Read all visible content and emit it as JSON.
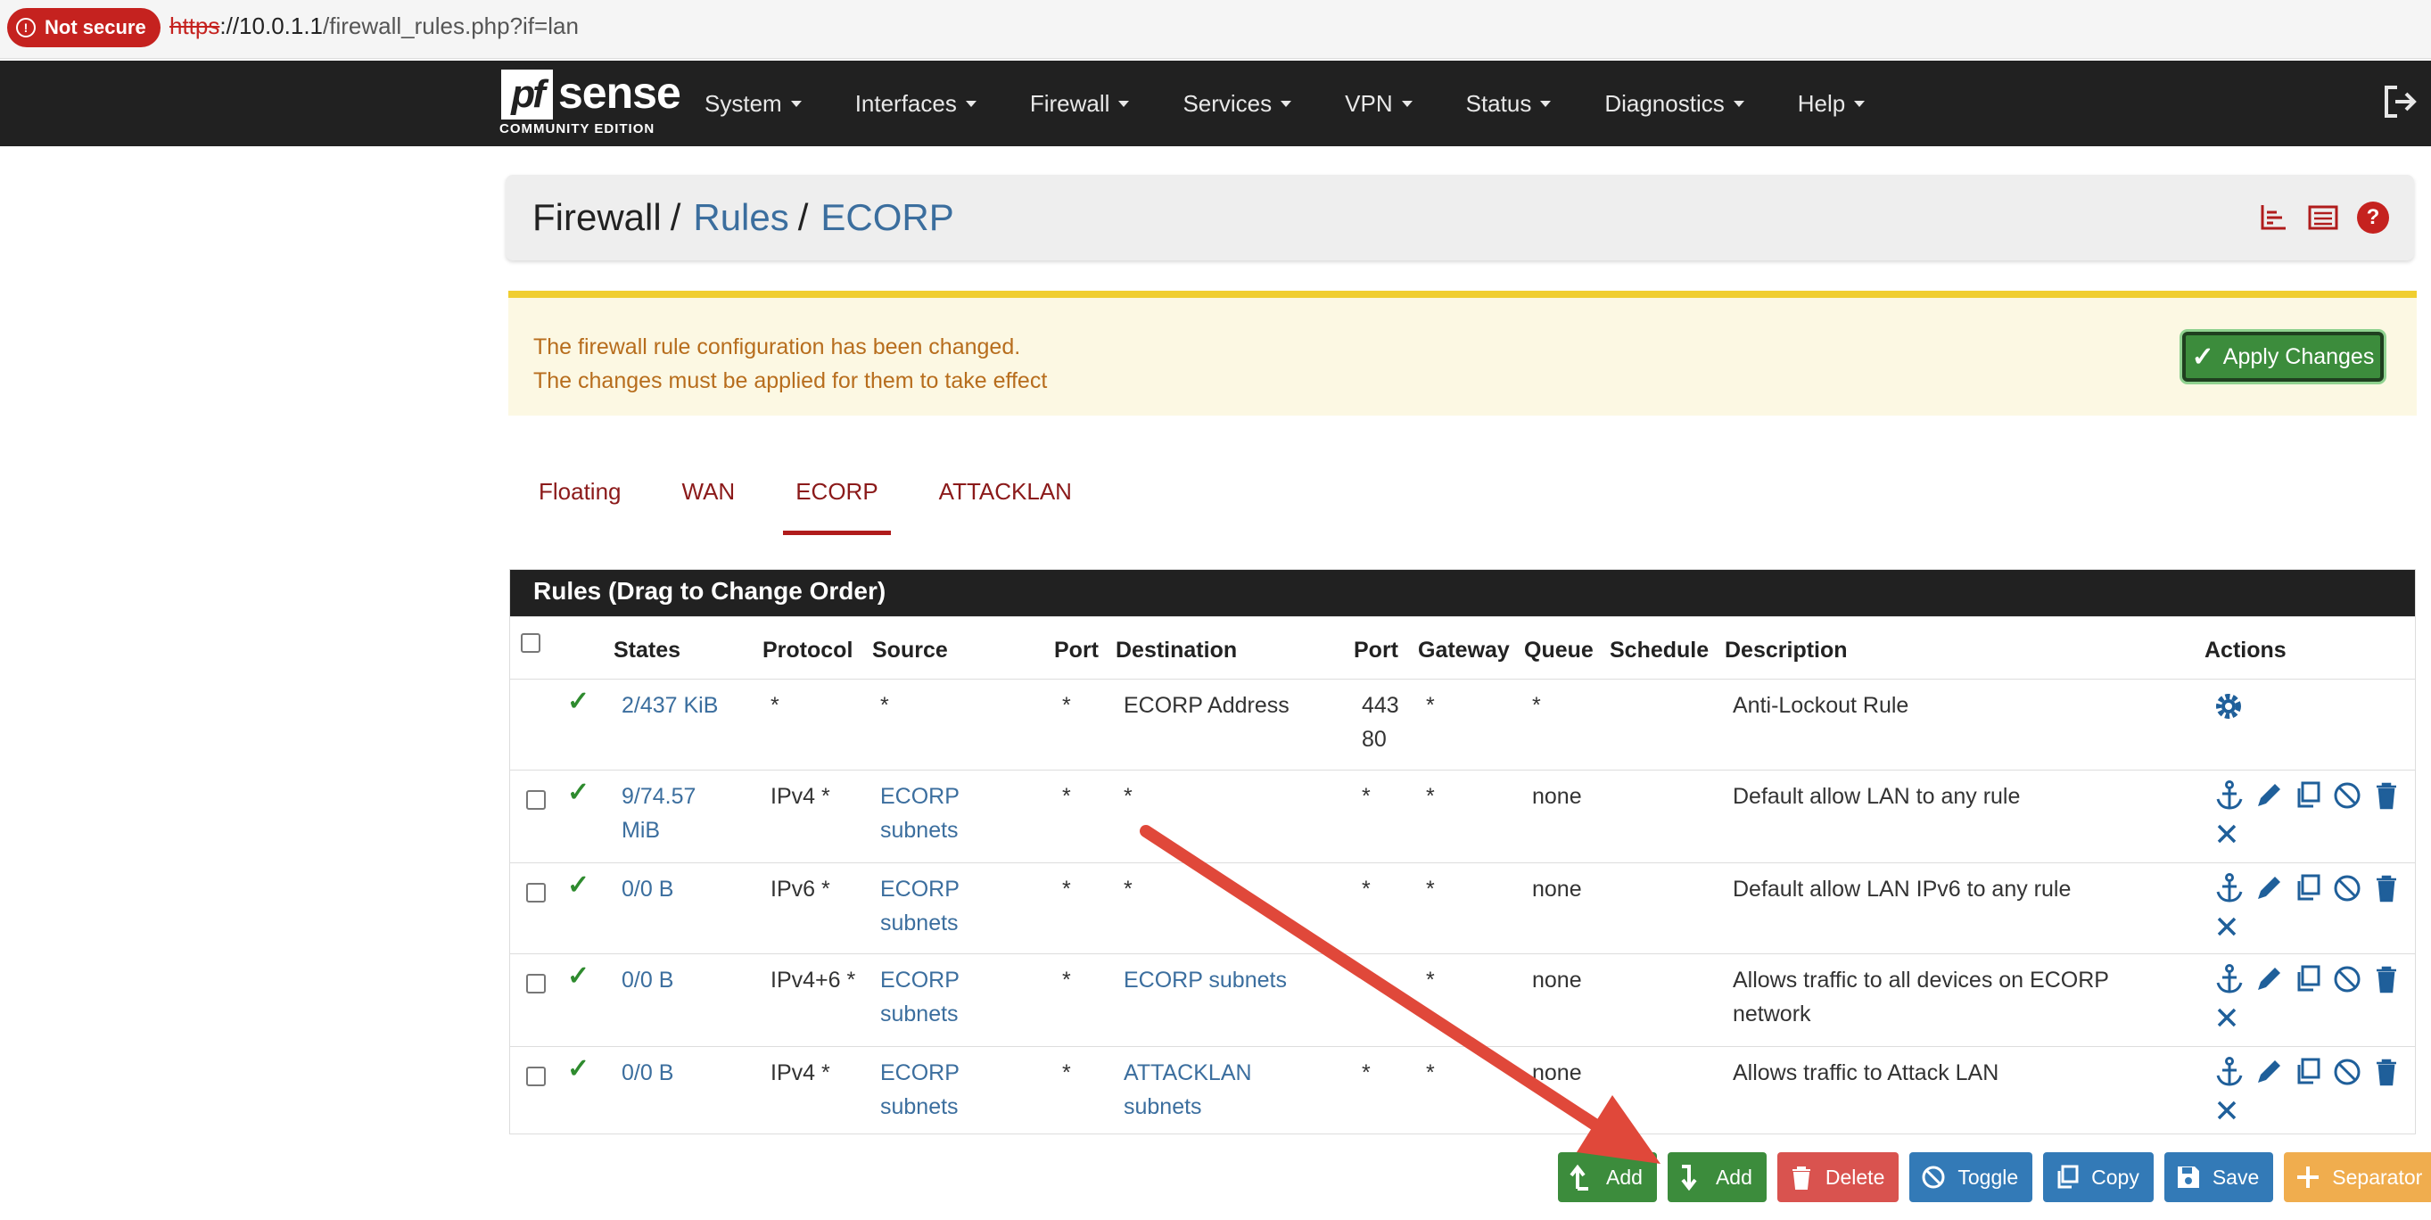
{
  "browser": {
    "security_label": "Not secure",
    "url_scheme": "https",
    "url_host": "://10.0.1.1",
    "url_path": "/firewall_rules.php?if=lan"
  },
  "navbar": {
    "logo_pf": "pf",
    "logo_sense": "sense",
    "logo_edition": "COMMUNITY EDITION",
    "menu": [
      "System",
      "Interfaces",
      "Firewall",
      "Services",
      "VPN",
      "Status",
      "Diagnostics",
      "Help"
    ]
  },
  "breadcrumb": {
    "root": "Firewall",
    "sep1": "/",
    "rules": "Rules",
    "sep2": "/",
    "current": "ECORP"
  },
  "alert": {
    "line1": "The firewall rule configuration has been changed.",
    "line2": "The changes must be applied for them to take effect",
    "apply_label": "Apply Changes"
  },
  "tabs": [
    "Floating",
    "WAN",
    "ECORP",
    "ATTACKLAN"
  ],
  "active_tab": "ECORP",
  "table": {
    "title": "Rules (Drag to Change Order)",
    "headers": {
      "states": "States",
      "protocol": "Protocol",
      "source": "Source",
      "port": "Port",
      "destination": "Destination",
      "dport": "Port",
      "gateway": "Gateway",
      "queue": "Queue",
      "schedule": "Schedule",
      "description": "Description",
      "actions": "Actions"
    },
    "rows": [
      {
        "states": "2/437 KiB",
        "protocol": "*",
        "source": "*",
        "port": "*",
        "destination": "ECORP Address",
        "dport": "443\n80",
        "gateway": "*",
        "queue": "*",
        "schedule": "",
        "description": "Anti-Lockout Rule"
      },
      {
        "states": "9/74.57 MiB",
        "protocol": "IPv4 *",
        "source": "ECORP subnets",
        "port": "*",
        "destination": "*",
        "dport": "*",
        "gateway": "*",
        "queue": "none",
        "schedule": "",
        "description": "Default allow LAN to any rule"
      },
      {
        "states": "0/0 B",
        "protocol": "IPv6 *",
        "source": "ECORP subnets",
        "port": "*",
        "destination": "*",
        "dport": "*",
        "gateway": "*",
        "queue": "none",
        "schedule": "",
        "description": "Default allow LAN IPv6 to any rule"
      },
      {
        "states": "0/0 B",
        "protocol": "IPv4+6 *",
        "source": "ECORP subnets",
        "port": "*",
        "destination": "ECORP subnets",
        "dport": "",
        "gateway": "*",
        "queue": "none",
        "schedule": "",
        "description": "Allows traffic to all devices on ECORP network"
      },
      {
        "states": "0/0 B",
        "protocol": "IPv4 *",
        "source": "ECORP subnets",
        "port": "*",
        "destination": "ATTACKLAN subnets",
        "dport": "*",
        "gateway": "*",
        "queue": "none",
        "schedule": "",
        "description": "Allows traffic to Attack LAN"
      }
    ]
  },
  "buttons": {
    "add_top": "Add",
    "add_bottom": "Add",
    "delete": "Delete",
    "toggle": "Toggle",
    "copy": "Copy",
    "save": "Save",
    "separator": "Separator"
  },
  "colors": {
    "navbar": "#212121",
    "accent_red": "#b01c1c",
    "link_blue": "#3b6e9e",
    "success_green": "#3c8c3c",
    "annotation_arrow": "#e0483a"
  }
}
